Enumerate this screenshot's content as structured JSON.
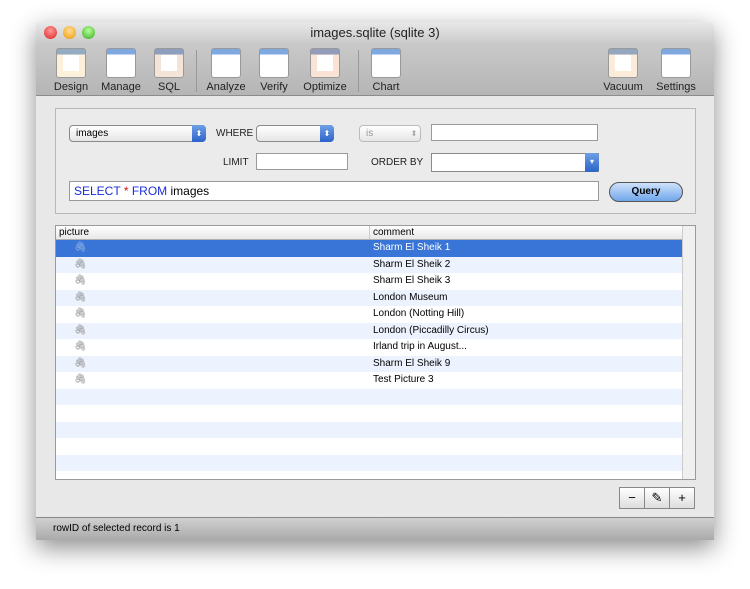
{
  "window": {
    "title": "images.sqlite (sqlite 3)"
  },
  "toolbar": [
    {
      "label": "Design",
      "icon": "pencil-icon"
    },
    {
      "label": "Manage",
      "icon": "traffic-light-icon"
    },
    {
      "label": "SQL",
      "icon": "glasses-icon"
    },
    {
      "label": "Analyze",
      "icon": "magnifier-icon"
    },
    {
      "label": "Verify",
      "icon": "stethoscope-icon"
    },
    {
      "label": "Optimize",
      "icon": "wrench-icon"
    },
    {
      "label": "Chart",
      "icon": "pie-chart-icon"
    },
    {
      "label": "Vacuum",
      "icon": "bell-jar-icon"
    },
    {
      "label": "Settings",
      "icon": "switch-icon"
    }
  ],
  "filter": {
    "table": "images",
    "where_label": "WHERE",
    "where_field": "",
    "operator": "is",
    "where_value": "",
    "limit_label": "LIMIT",
    "limit_value": "",
    "orderby_label": "ORDER BY",
    "orderby_value": "",
    "sql_select": "SELECT",
    "sql_star": "*",
    "sql_from": "FROM",
    "sql_table": "images",
    "query_button": "Query"
  },
  "table": {
    "columns": [
      "picture",
      "comment"
    ],
    "rows": [
      "Sharm El Sheik 1",
      "Sharm El Sheik 2",
      "Sharm El Sheik 3",
      "London Museum",
      "London (Notting Hill)",
      "London (Piccadilly Circus)",
      "Irland trip in August...",
      "Sharm El Sheik 9",
      "Test Picture 3"
    ],
    "selected_index": 0
  },
  "buttons": {
    "remove": "−",
    "edit": "✎",
    "add": "+"
  },
  "status": "rowID of selected record is 1"
}
